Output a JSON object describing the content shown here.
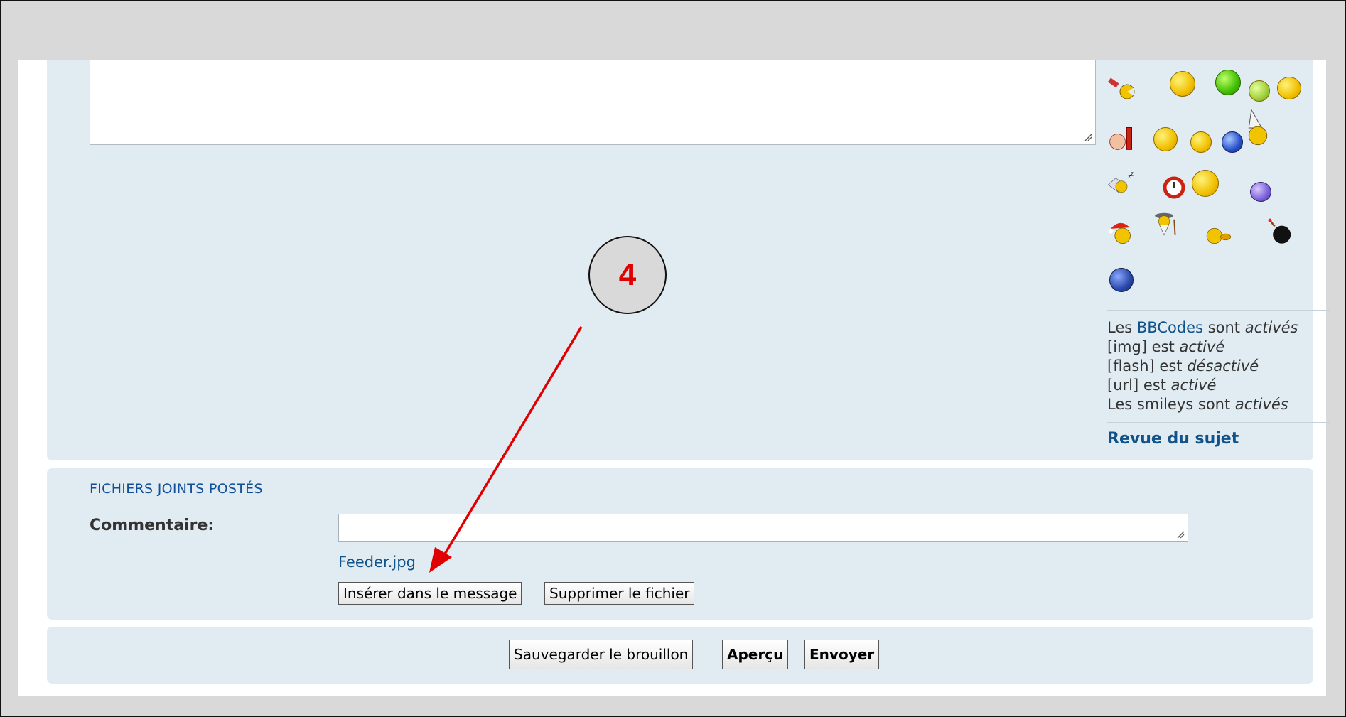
{
  "bbcode_info": {
    "line1_prefix": "Les ",
    "line1_link": "BBCodes",
    "line1_mid": " sont ",
    "line1_state": "activés",
    "line2_prefix": "[img] est ",
    "line2_state": "activé",
    "line3_prefix": "[flash] est ",
    "line3_state": "désactivé",
    "line4_prefix": "[url] est ",
    "line4_state": "activé",
    "line5_prefix": "Les smileys sont ",
    "line5_state": "activés"
  },
  "topic_review_link": "Revue du sujet",
  "attachments": {
    "heading": "FICHIERS JOINTS POSTÉS",
    "comment_label": "Commentaire:",
    "comment_value": "",
    "file_name": "Feeder.jpg",
    "insert_button": "Insérer dans le message",
    "delete_button": "Supprimer le fichier"
  },
  "submit": {
    "draft_button": "Sauvegarder le brouillon",
    "preview_button": "Aperçu",
    "send_button": "Envoyer"
  },
  "annotation": {
    "step_number": "4"
  },
  "smileys": [
    "pacman-icon",
    "sick-icon",
    "green-face-icon",
    "dizzy-icon",
    "angry-icon",
    "lol-icon",
    "cool-icon",
    "grin-icon",
    "rolleyes-icon",
    "party-hat-icon",
    "sleep-icon",
    "alarm-clock-icon",
    "wakeup-icon",
    "cold-icon",
    "santa-icon",
    "wizard-icon",
    "whistle-icon",
    "bomb-icon",
    "blue-face-icon"
  ],
  "colors": {
    "panel_bg": "#e1ebf2",
    "link": "#105289",
    "annotation_red": "#e00000"
  }
}
